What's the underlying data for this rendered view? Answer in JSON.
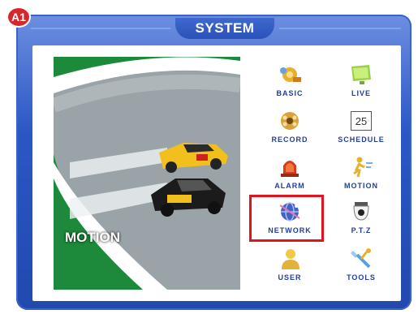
{
  "badge": "A1",
  "window_title": "SYSTEM",
  "image_caption": "MOTION",
  "menu": [
    {
      "label": "BASIC",
      "icon": "basic-gear-icon"
    },
    {
      "label": "LIVE",
      "icon": "live-monitor-icon"
    },
    {
      "label": "RECORD",
      "icon": "record-film-icon"
    },
    {
      "label": "SCHEDULE",
      "icon": "calendar-icon",
      "day": "25"
    },
    {
      "label": "ALARM",
      "icon": "alarm-siren-icon"
    },
    {
      "label": "MOTION",
      "icon": "motion-runner-icon"
    },
    {
      "label": "NETWORK",
      "icon": "network-globe-icon"
    },
    {
      "label": "P.T.Z",
      "icon": "ptz-camera-icon"
    },
    {
      "label": "USER",
      "icon": "user-icon"
    },
    {
      "label": "TOOLS",
      "icon": "tools-icon"
    }
  ],
  "colors": {
    "frame": "#2b57c5",
    "label": "#2040a0",
    "highlight": "#e1141e"
  }
}
